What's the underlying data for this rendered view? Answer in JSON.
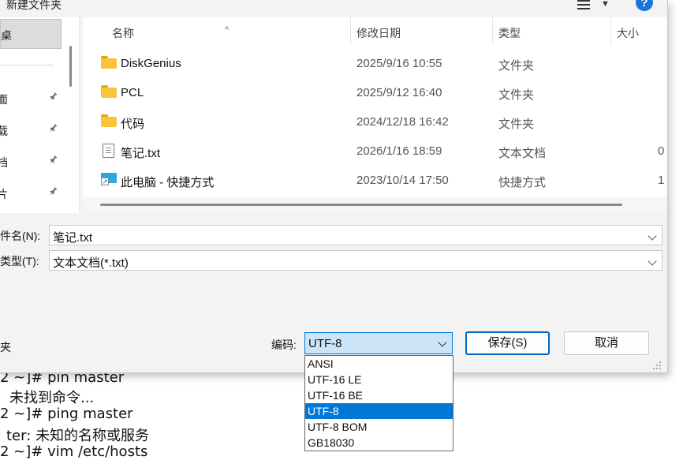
{
  "toolbar": {
    "new_folder": "新建文件夹",
    "help": "?"
  },
  "nav": {
    "selected_label": "桌",
    "items": [
      {
        "label": "面"
      },
      {
        "label": "载"
      },
      {
        "label": "档"
      },
      {
        "label": "片"
      }
    ]
  },
  "file_list": {
    "columns": {
      "name": "名称",
      "date": "修改日期",
      "type": "类型",
      "size": "大小"
    },
    "rows": [
      {
        "icon": "folder-icon",
        "name": "DiskGenius",
        "date": "2025/9/16 10:55",
        "type": "文件夹",
        "size": ""
      },
      {
        "icon": "folder-icon",
        "name": "PCL",
        "date": "2025/9/12 16:40",
        "type": "文件夹",
        "size": ""
      },
      {
        "icon": "folder-icon",
        "name": "代码",
        "date": "2024/12/18 16:42",
        "type": "文件夹",
        "size": ""
      },
      {
        "icon": "text-file-icon",
        "name": "笔记.txt",
        "date": "2026/1/16 18:59",
        "type": "文本文档",
        "size": "0"
      },
      {
        "icon": "shortcut-icon",
        "name": "此电脑 - 快捷方式",
        "date": "2023/10/14 17:50",
        "type": "快捷方式",
        "size": "1"
      }
    ]
  },
  "form": {
    "filename_label": "件名(N):",
    "filename_value": "笔记.txt",
    "filetype_label": "类型(T):",
    "filetype_value": "文本文档(*.txt)",
    "hide_folders_label": "夹",
    "encoding_label": "编码:",
    "encoding_value": "UTF-8",
    "save_label": "保存(S)",
    "cancel_label": "取消"
  },
  "encoding_options": [
    "ANSI",
    "UTF-16 LE",
    "UTF-16 BE",
    "UTF-8",
    "UTF-8 BOM",
    "GB18030"
  ],
  "encoding_selected": "UTF-8",
  "terminal": {
    "lines": [
      "2 ~]# pin master",
      "未找到命令...",
      "2 ~]# ping master",
      "ter: 未知的名称或服务",
      "2 ~]# vim /etc/hosts"
    ]
  },
  "colors": {
    "accent": "#0078d7",
    "help_button": "#1976d2",
    "folder": "#f8c43a"
  }
}
